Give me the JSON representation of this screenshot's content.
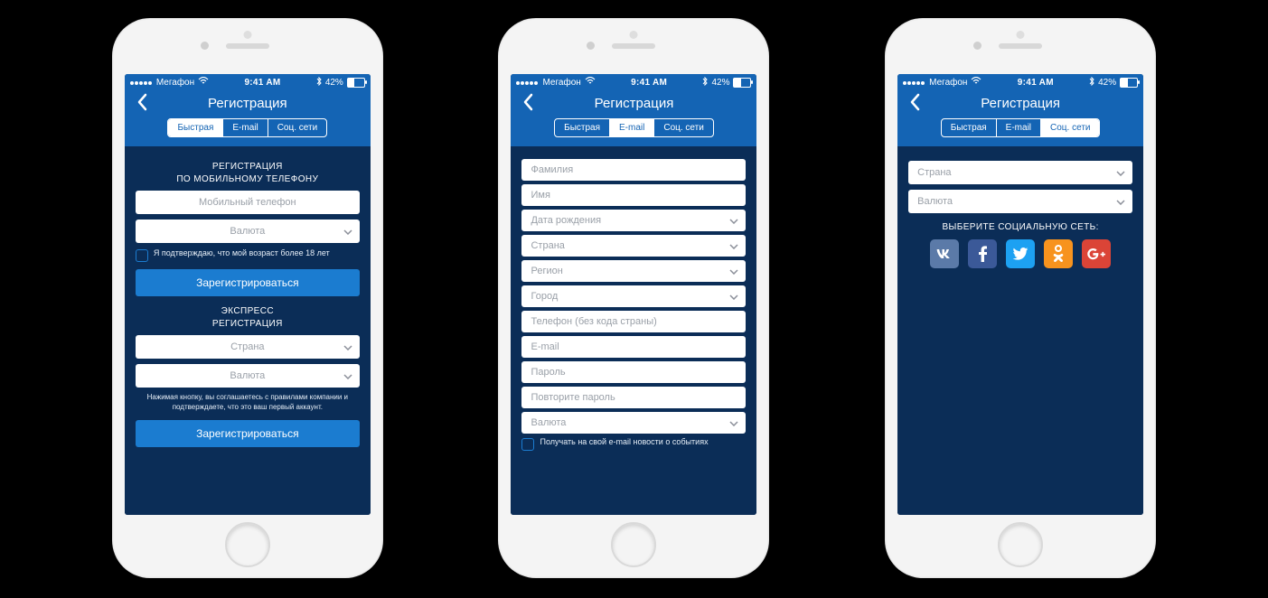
{
  "statusbar": {
    "carrier": "Мегафон",
    "time": "9:41 AM",
    "battery": "42%"
  },
  "nav": {
    "title": "Регистрация",
    "tabs": [
      "Быстрая",
      "E-mail",
      "Соц. сети"
    ]
  },
  "screen1": {
    "heading1a": "РЕГИСТРАЦИЯ",
    "heading1b": "ПО МОБИЛЬНОМУ ТЕЛЕФОНУ",
    "phone_ph": "Мобильный телефон",
    "currency_ph": "Валюта",
    "checkbox": "Я подтверждаю, что мой возраст более 18 лет",
    "btn": "Зарегистрироваться",
    "heading2a": "ЭКСПРЕСС",
    "heading2b": "РЕГИСТРАЦИЯ",
    "country_ph": "Страна",
    "disclaimer": "Нажимая кнопку, вы соглашаетесь с правилами компании и подтверждаете, что это ваш первый аккаунт."
  },
  "screen2": {
    "lastname_ph": "Фамилия",
    "firstname_ph": "Имя",
    "dob_ph": "Дата рождения",
    "country_ph": "Страна",
    "region_ph": "Регион",
    "city_ph": "Город",
    "phone_ph": "Телефон (без кода страны)",
    "email_ph": "E-mail",
    "password_ph": "Пароль",
    "password2_ph": "Повторите пароль",
    "currency_ph": "Валюта",
    "checkbox": "Получать на свой e-mail новости о событиях"
  },
  "screen3": {
    "country_ph": "Страна",
    "currency_ph": "Валюта",
    "social_label": "ВЫБЕРИТЕ СОЦИАЛЬНУЮ СЕТЬ:"
  }
}
